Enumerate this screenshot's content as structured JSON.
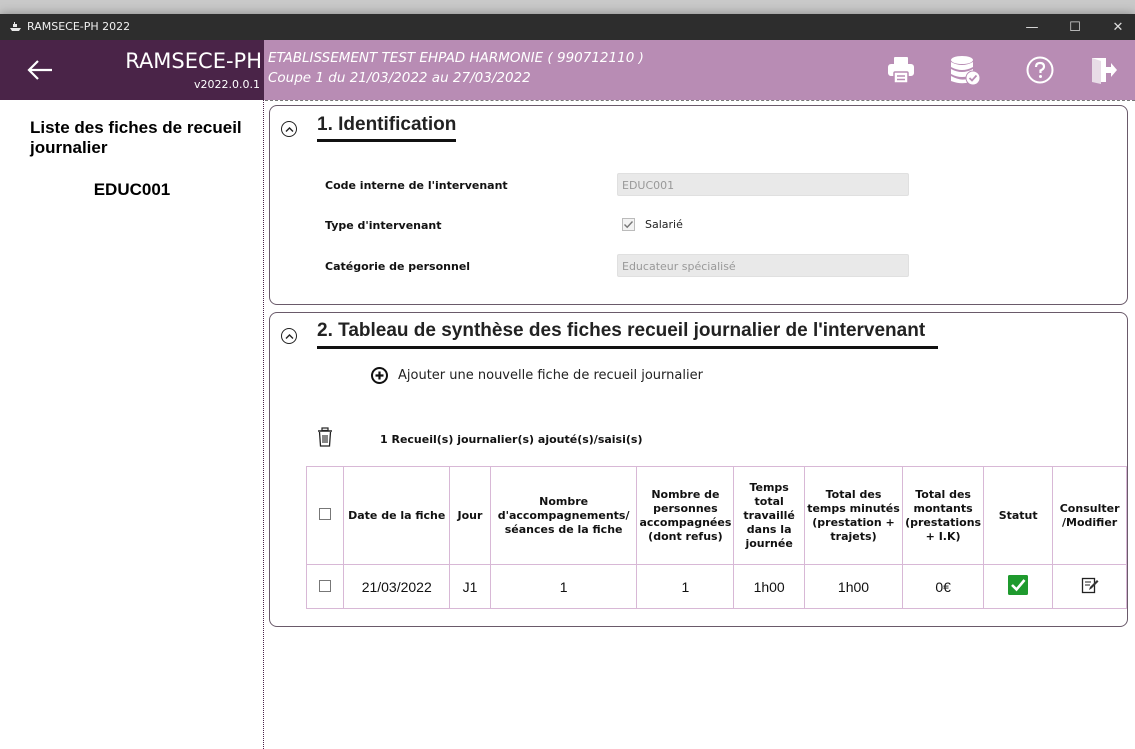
{
  "window": {
    "title": "RAMSECE-PH 2022",
    "controls": {
      "minimize": "—",
      "maximize": "☐",
      "close": "✕"
    }
  },
  "header": {
    "app_name": "RAMSECE-PH",
    "version": "v2022.0.0.1",
    "establishment": "ETABLISSEMENT TEST EHPAD HARMONIE ( 990712110 )",
    "period": "Coupe 1 du 21/03/2022 au 27/03/2022",
    "icons": [
      "back-arrow-icon",
      "print-icon",
      "database-check-icon",
      "help-icon",
      "logout-icon"
    ]
  },
  "sidebar": {
    "title": "Liste des fiches de recueil journalier",
    "code": "EDUC001"
  },
  "section1": {
    "title": "1. Identification",
    "fields": {
      "code_label": "Code interne de l'intervenant",
      "code_value": "EDUC001",
      "type_label": "Type d'intervenant",
      "type_option": "Salarié",
      "type_checked": true,
      "category_label": "Catégorie de personnel",
      "category_value": "Educateur spécialisé"
    }
  },
  "section2": {
    "title": "2. Tableau de synthèse des fiches recueil journalier de l'intervenant",
    "add_label": "Ajouter une nouvelle fiche de recueil journalier",
    "count_label": "1 Recueil(s) journalier(s) ajouté(s)/saisi(s)",
    "table": {
      "headers": {
        "date": "Date de la fiche",
        "jour": "Jour",
        "nb_acc": "Nombre d'accompagnements/ séances de la fiche",
        "nb_pers": "Nombre de personnes accompagnées (dont refus)",
        "temps": "Temps total travaillé dans la journée",
        "total_temps": "Total des temps minutés (prestation + trajets)",
        "total_montants": "Total des montants (prestations + I.K)",
        "statut": "Statut",
        "consulter": "Consulter /Modifier"
      },
      "rows": [
        {
          "date": "21/03/2022",
          "jour": "J1",
          "nb_acc": "1",
          "nb_pers": "1",
          "temps": "1h00",
          "total_temps": "1h00",
          "total_montants": "0€",
          "statut": "valid",
          "statut_color": "#1f9a2e"
        }
      ]
    }
  },
  "colors": {
    "header_dark": "#4a2448",
    "header_light": "#b88cb4",
    "table_border": "#d8b8d6"
  }
}
